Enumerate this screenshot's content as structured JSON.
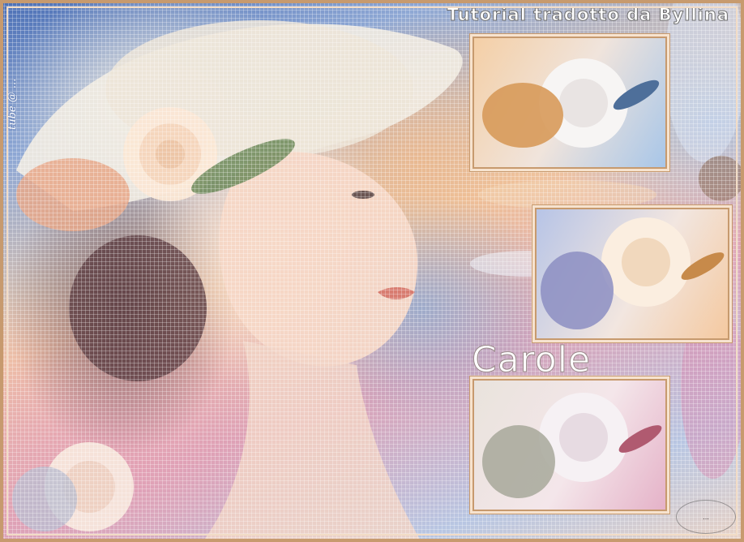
{
  "header": {
    "title": "Tutorial tradotto da Byllina"
  },
  "credits": {
    "vertical_text": "tube @ ..."
  },
  "artwork": {
    "name": "Carole",
    "watermark": "..."
  },
  "colors": {
    "frame_gold": "#c79a6e",
    "text_white": "#ffffff"
  },
  "thumbnails": [
    {
      "variant": "orange-white rose"
    },
    {
      "variant": "blue-peach rose"
    },
    {
      "variant": "grey-pink rose"
    }
  ]
}
